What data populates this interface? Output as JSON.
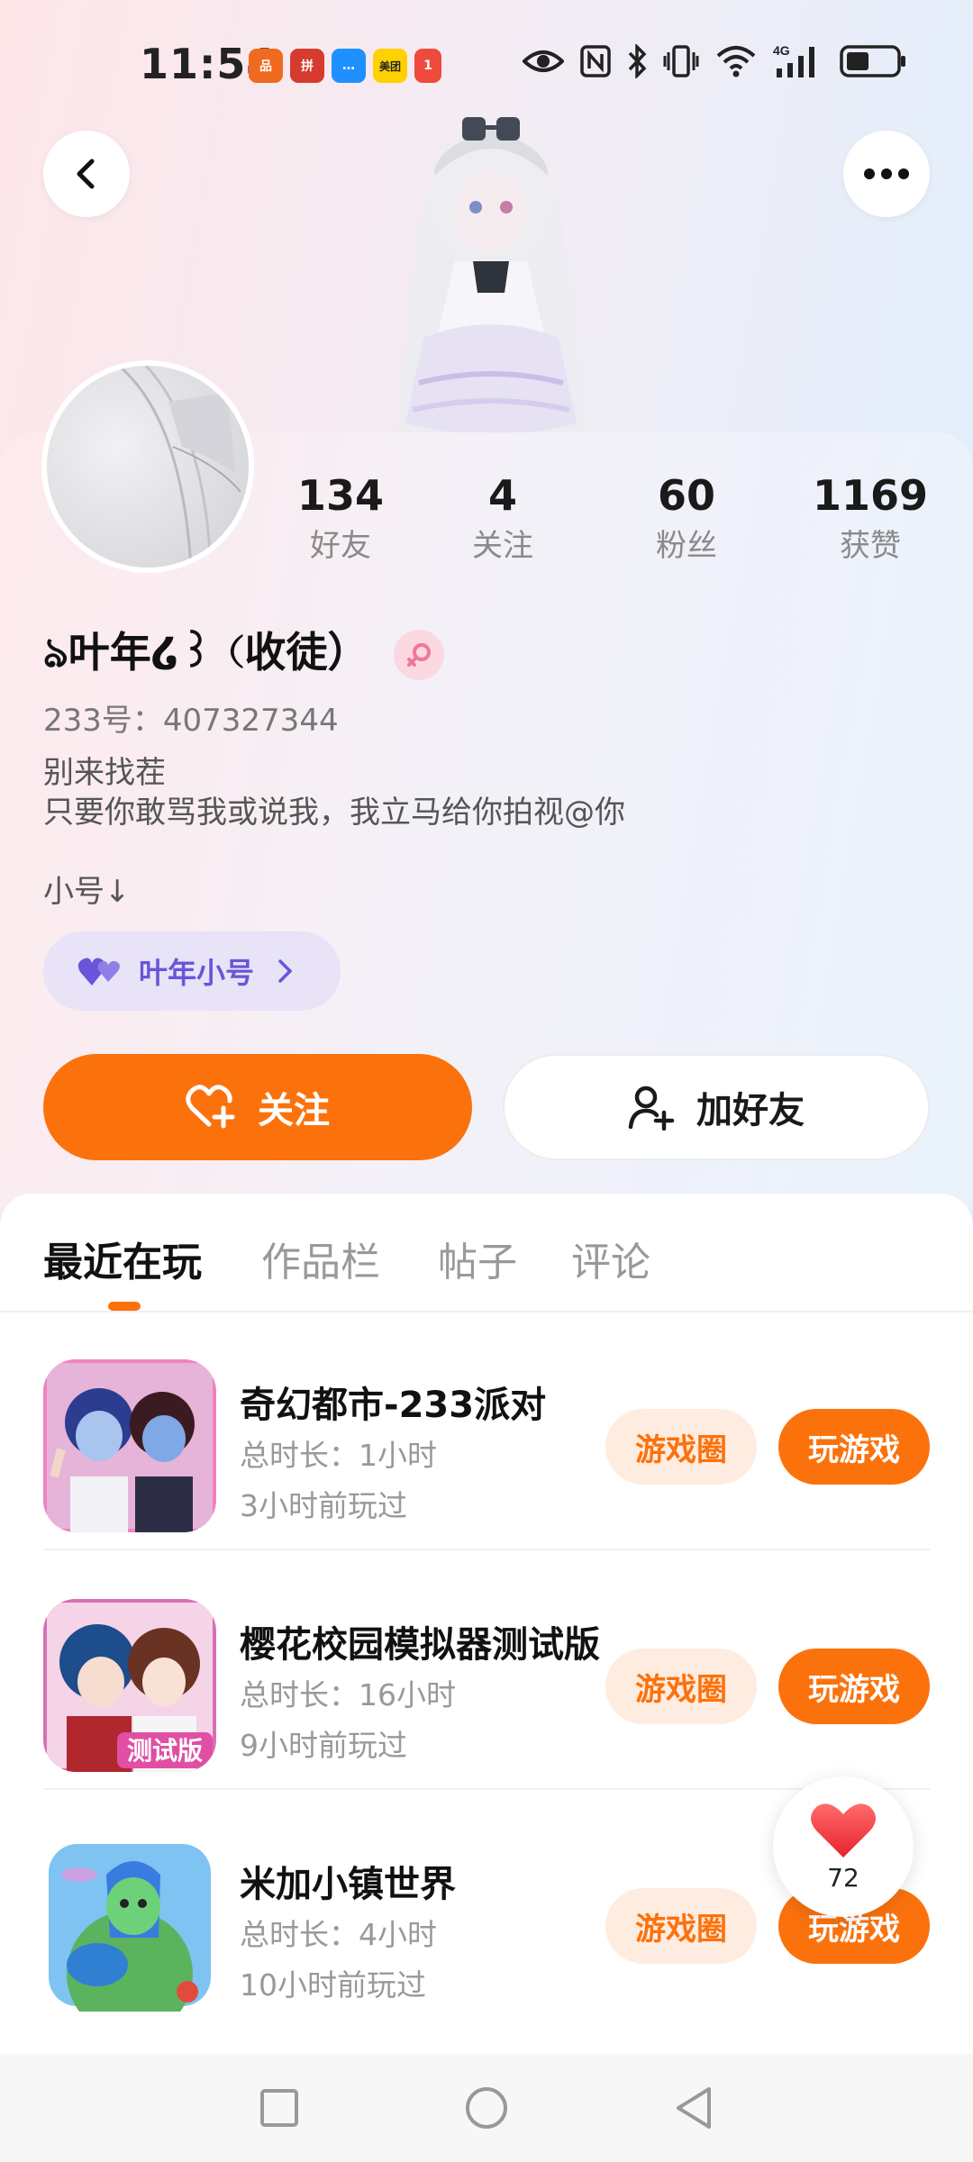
{
  "status_bar": {
    "time": "11:54",
    "app_icons": [
      {
        "icon": "app-orange-icon",
        "color": "#f06a1f",
        "text": "品"
      },
      {
        "icon": "app-red-icon",
        "color": "#d73a2f",
        "text": "拼"
      },
      {
        "icon": "app-message-icon",
        "color": "#1e90ff",
        "text": "…"
      },
      {
        "icon": "meituan-icon",
        "color": "#ffd100",
        "text": "美团"
      },
      {
        "icon": "app-notify-icon",
        "color": "#ef4a3b",
        "text": "1"
      }
    ],
    "right_icons": [
      "eye-icon",
      "nfc-icon",
      "bluetooth-icon",
      "vibrate-icon",
      "wifi-icon",
      "signal-4g-icon",
      "battery-icon"
    ],
    "network_label": "4G"
  },
  "header": {
    "back_icon": "chevron-left-icon",
    "more_icon": "more-dots-icon"
  },
  "profile": {
    "stats": [
      {
        "value": "134",
        "label": "好友"
      },
      {
        "value": "4",
        "label": "关注"
      },
      {
        "value": "60",
        "label": "粉丝"
      },
      {
        "value": "1169",
        "label": "获赞"
      }
    ],
    "nickname": "ঌ叶年໒꒱（收徒）",
    "gender_icon": "female-icon",
    "uid": "233号：407327344",
    "bio_line1": "别来找茬",
    "bio_line2": "只要你敢骂我或说我，我立马给你拍视@你",
    "sub_note": "小号↓",
    "alt_account_label": "叶年小号",
    "follow_label": "关注",
    "add_friend_label": "加好友"
  },
  "tabs": [
    {
      "label": "最近在玩",
      "active": true
    },
    {
      "label": "作品栏",
      "active": false
    },
    {
      "label": "帖子",
      "active": false
    },
    {
      "label": "评论",
      "active": false
    }
  ],
  "games": [
    {
      "title": "奇幻都市-233派对",
      "duration": "总时长：1小时",
      "last_played": "3小时前玩过",
      "circle_label": "游戏圈",
      "play_label": "玩游戏"
    },
    {
      "title": "樱花校园模拟器测试版",
      "duration": "总时长：16小时",
      "last_played": "9小时前玩过",
      "circle_label": "游戏圈",
      "play_label": "玩游戏",
      "icon_badge": "测试版"
    },
    {
      "title": "米加小镇世界",
      "duration": "总时长：4小时",
      "last_played": "10小时前玩过",
      "circle_label": "游戏圈",
      "play_label": "玩游戏"
    }
  ],
  "like_float": {
    "count": "72",
    "icon": "heart-icon"
  },
  "nav_bar": {
    "icons": [
      "recent-apps-icon",
      "home-icon",
      "back-icon"
    ]
  },
  "colors": {
    "accent": "#fb720d",
    "accent_light": "#ffece0",
    "chip_purple": "#6a55d8",
    "chip_bg": "#e8e3f7"
  }
}
